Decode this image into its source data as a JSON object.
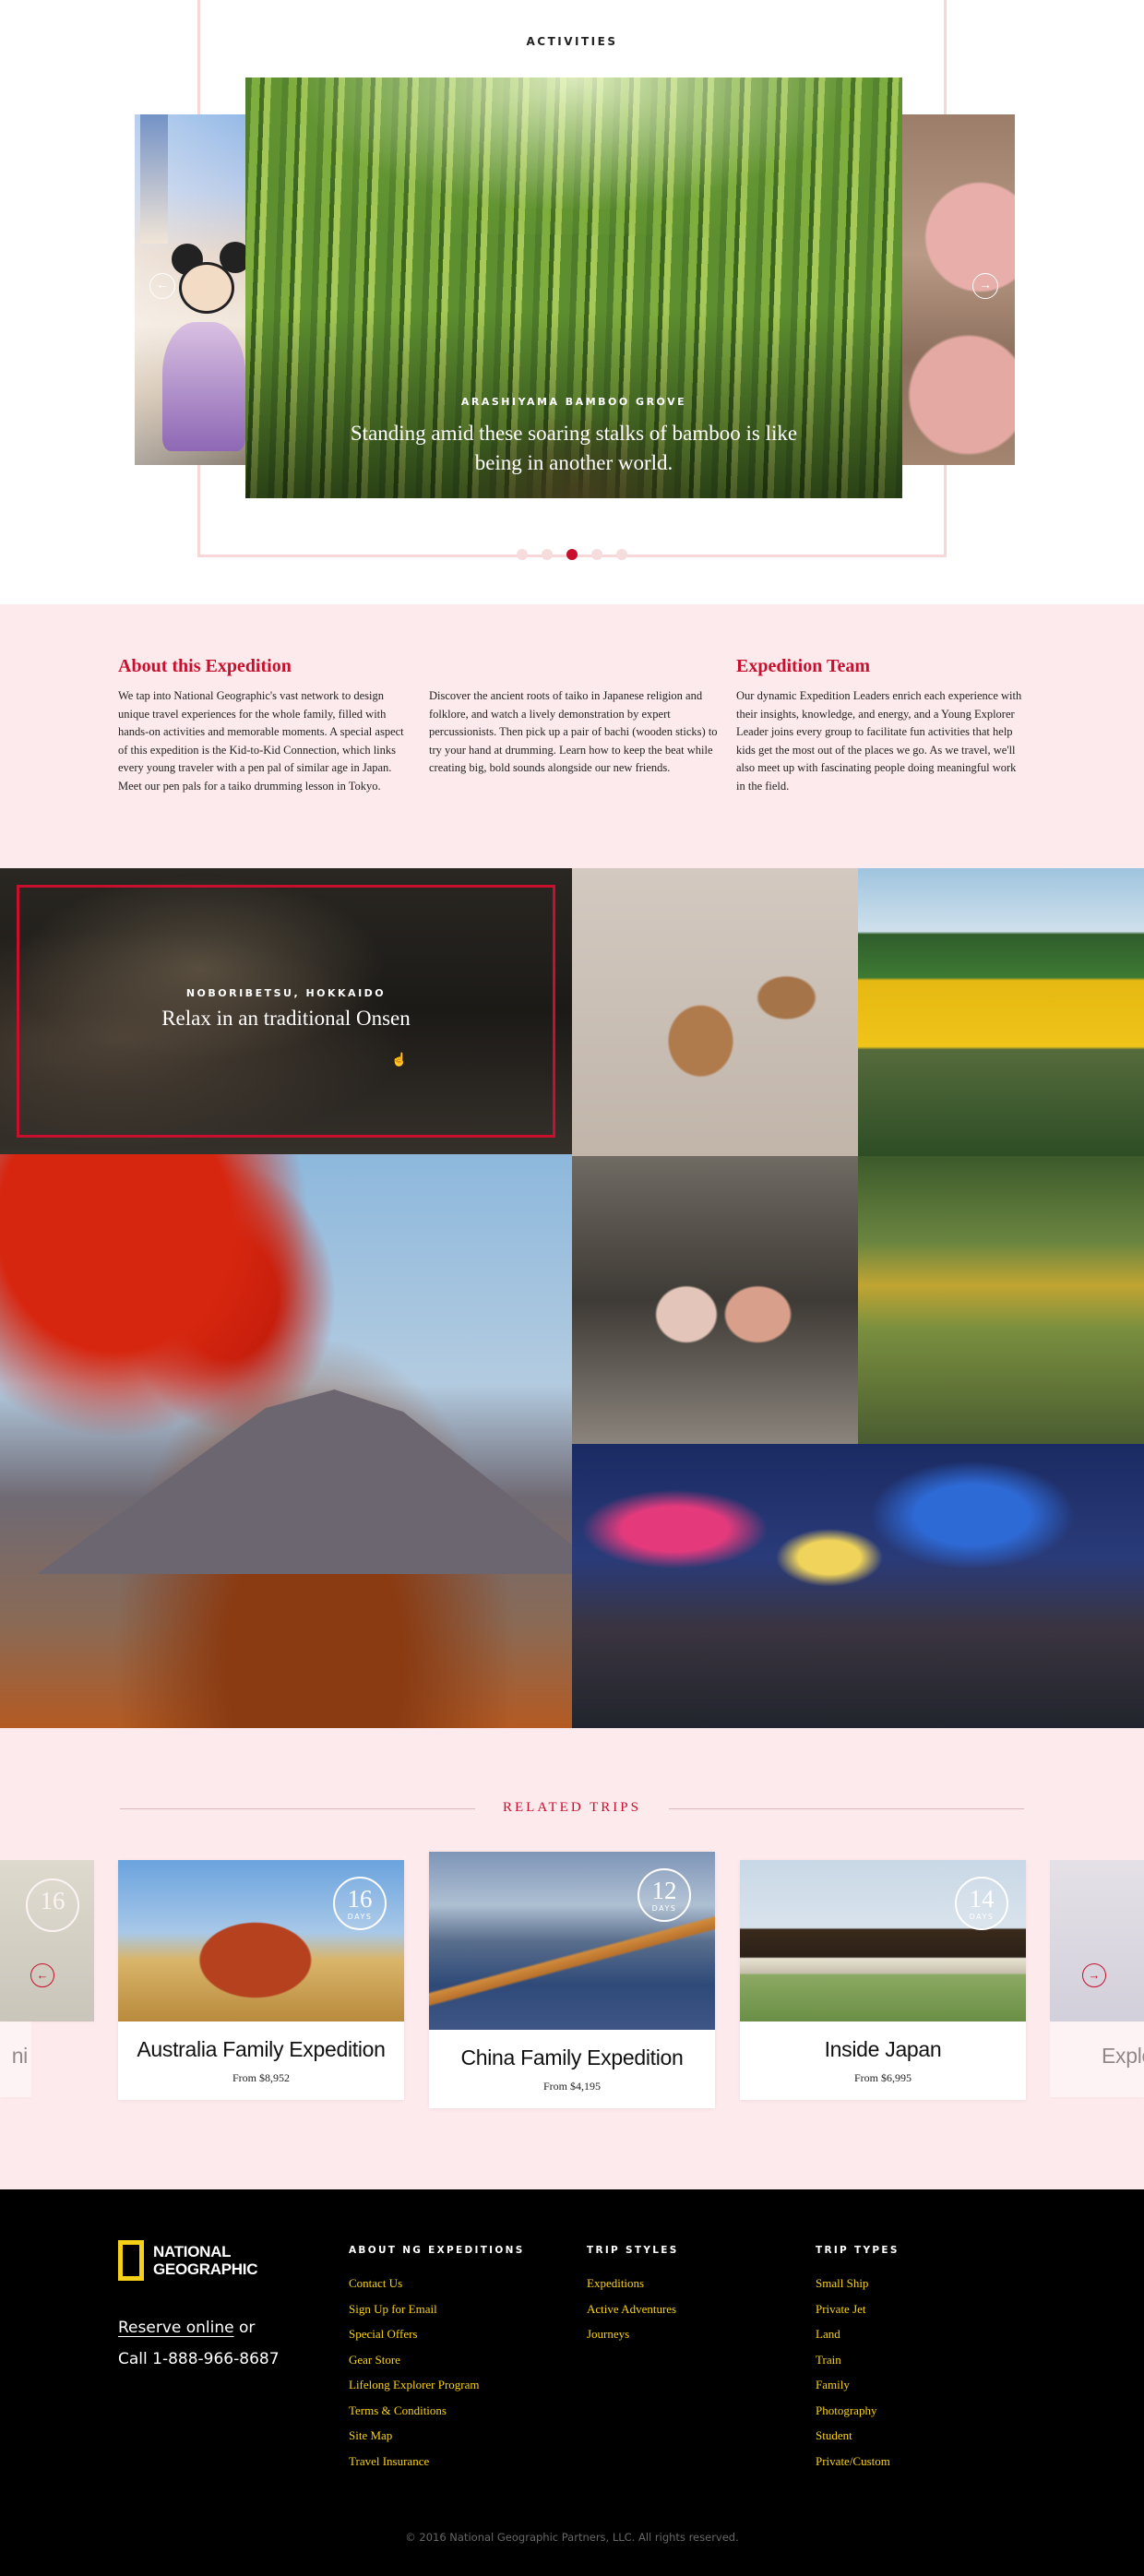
{
  "activities": {
    "title": "ACTIVITIES",
    "slide": {
      "kicker": "ARASHIYAMA BAMBOO GROVE",
      "caption": "Standing amid these soaring stalks of bamboo is like being in another world."
    },
    "dots_count": 5,
    "active_dot": 3
  },
  "about": {
    "heading": "About this Expedition",
    "para1": "We tap into National Geographic's vast network to design unique travel experiences for the whole family, filled with hands-on activities and memorable moments. A special aspect of this expedition is the Kid-to-Kid Connection, which links every young traveler with a pen pal of similar age in Japan. Meet our pen pals for a taiko drumming lesson in Tokyo.",
    "para2": "Discover the ancient roots of taiko in Japanese religion and folklore, and watch a lively demonstration by expert percussionists. Then pick up a pair of bachi (wooden sticks) to try your hand at drumming. Learn how to keep the beat while creating big, bold sounds alongside our new friends.",
    "team_heading": "Expedition Team",
    "team_para": "Our dynamic Expedition Leaders enrich each experience with their insights, knowledge, and energy, and a Young Explorer Leader joins every group to facilitate fun activities that help kids get the most out of the places we go. As we travel, we'll also meet up with fascinating people doing meaningful work in the field."
  },
  "gallery": {
    "feature_kicker": "NOBORIBETSU, HOKKAIDO",
    "feature_title": "Relax in an traditional Onsen"
  },
  "related": {
    "title": "RELATED TRIPS",
    "ghost_left_days": "16",
    "ghost_left_name": "ni",
    "ghost_right_name": "Explo",
    "trips": [
      {
        "name": "Australia Family Expedition",
        "price": "From $8,952",
        "days": "16",
        "days_label": "DAYS"
      },
      {
        "name": "China Family Expedition",
        "price": "From $4,195",
        "days": "12",
        "days_label": "DAYS"
      },
      {
        "name": "Inside Japan",
        "price": "From $6,995",
        "days": "14",
        "days_label": "DAYS"
      }
    ]
  },
  "footer": {
    "logo_line1": "NATIONAL",
    "logo_line2": "GEOGRAPHIC",
    "reserve_link": "Reserve online",
    "reserve_suffix": " or",
    "phone": "Call 1-888-966-8687",
    "col1": {
      "heading": "ABOUT NG EXPEDITIONS",
      "links": [
        "Contact Us",
        "Sign Up for Email",
        "Special Offers",
        "Gear Store",
        "Lifelong Explorer Program",
        "Terms & Conditions",
        "Site Map",
        "Travel Insurance"
      ]
    },
    "col2": {
      "heading": "TRIP STYLES",
      "links": [
        "Expeditions",
        "Active Adventures",
        "Journeys"
      ]
    },
    "col3": {
      "heading": "TRIP TYPES",
      "links": [
        "Small Ship",
        "Private Jet",
        "Land",
        "Train",
        "Family",
        "Photography",
        "Student",
        "Private/Custom"
      ]
    },
    "copyright": "© 2016 National Geographic Partners, LLC. All rights reserved."
  }
}
